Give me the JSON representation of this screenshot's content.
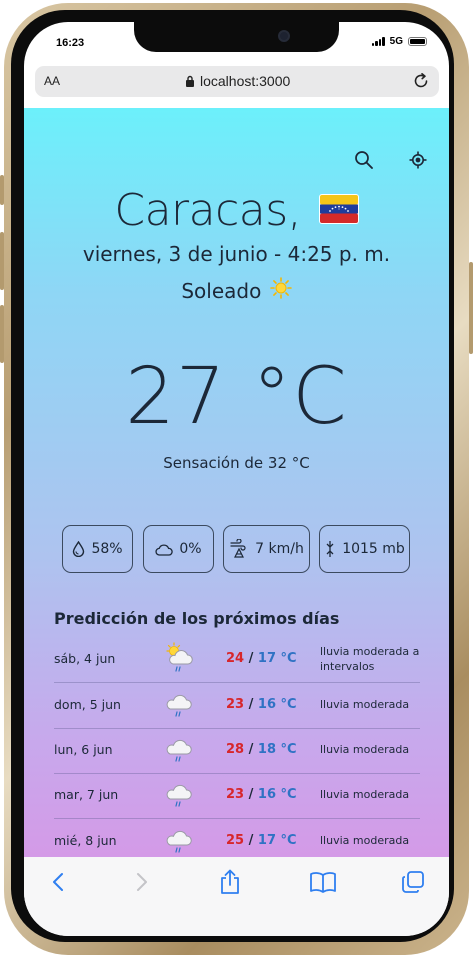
{
  "status_bar": {
    "time": "16:23",
    "network": "5G"
  },
  "browser": {
    "aa_label": "AA",
    "url": "localhost:3000"
  },
  "weather": {
    "city": "Caracas,",
    "date_time": "viernes, 3 de junio - 4:25 p. m.",
    "condition": "Soleado",
    "temperature": "27 °C",
    "feels_like": "Sensación de 32 °C",
    "stats": {
      "humidity": "58%",
      "cloudiness": "0%",
      "wind": "7 km/h",
      "pressure": "1015 mb"
    }
  },
  "forecast": {
    "title": "Predicción de los próximos días",
    "days": [
      {
        "day": "sáb, 4 jun",
        "max": "24",
        "min": "17 °C",
        "description": "lluvia moderada a intervalos",
        "icon": "sun-cloud-rain-icon"
      },
      {
        "day": "dom, 5 jun",
        "max": "23",
        "min": "16 °C",
        "description": "lluvia moderada",
        "icon": "cloud-rain-icon"
      },
      {
        "day": "lun, 6 jun",
        "max": "28",
        "min": "18 °C",
        "description": "lluvia moderada",
        "icon": "cloud-rain-icon"
      },
      {
        "day": "mar, 7 jun",
        "max": "23",
        "min": "16 °C",
        "description": "lluvia moderada",
        "icon": "cloud-rain-icon"
      },
      {
        "day": "mié, 8 jun",
        "max": "25",
        "min": "17 °C",
        "description": "lluvia moderada",
        "icon": "cloud-rain-icon"
      }
    ]
  },
  "colors": {
    "accent_blue": "#2f7ff0",
    "max_temp": "#d7262b",
    "min_temp": "#2f72c4",
    "gradient_top": "#6cf0fb",
    "gradient_bottom": "#d49ae7"
  }
}
